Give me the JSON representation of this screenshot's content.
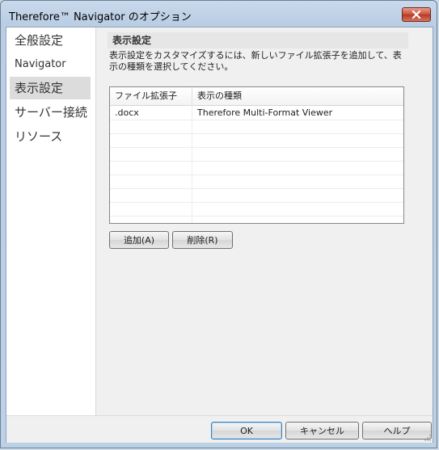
{
  "window": {
    "title": "Therefore™ Navigator のオプション"
  },
  "sidebar": {
    "items": [
      {
        "label": "全般設定"
      },
      {
        "label": "Navigator"
      },
      {
        "label": "表示設定",
        "selected": true
      },
      {
        "label": "サーバー接続"
      },
      {
        "label": "リソース"
      }
    ]
  },
  "content": {
    "section_title": "表示設定",
    "description": "表示設定をカスタマイズするには、新しいファイル拡張子を追加して、表示の種類を選択してください。",
    "table": {
      "columns": [
        "ファイル拡張子",
        "表示の種類"
      ],
      "rows": [
        [
          ".docx",
          "Therefore Multi-Format Viewer"
        ]
      ]
    },
    "add_label": "追加(A)",
    "delete_label": "削除(R)"
  },
  "footer": {
    "ok_label": "OK",
    "cancel_label": "キャンセル",
    "help_label": "ヘルプ"
  },
  "colors": {
    "selected_nav": "#dcdcdc",
    "close_button": "#c8503a"
  }
}
